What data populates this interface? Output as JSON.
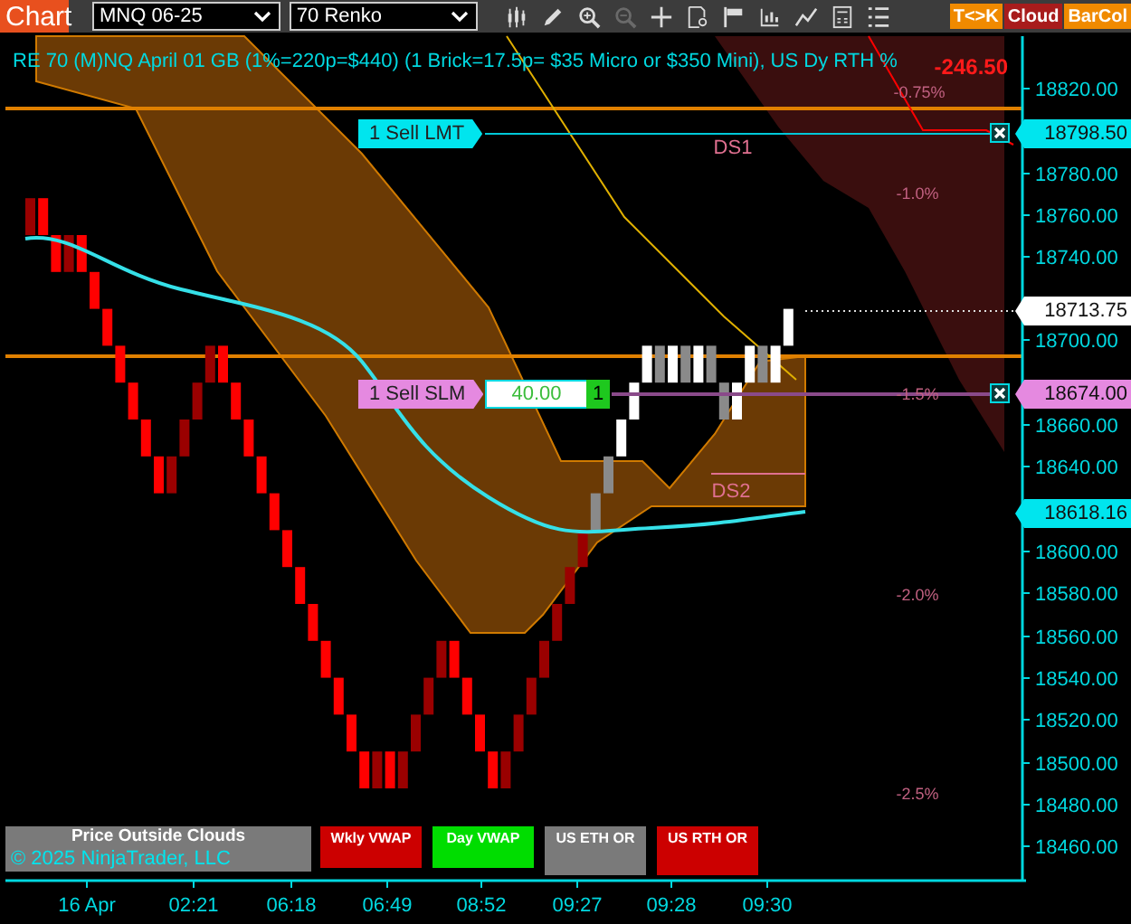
{
  "toolbar": {
    "app_button": "Chart",
    "instrument": "MNQ 06-25",
    "interval": "70 Renko",
    "tools": [
      {
        "disabled": false
      },
      {
        "disabled": false
      },
      {
        "disabled": false
      },
      {
        "disabled": true
      },
      {
        "disabled": false
      },
      {
        "disabled": false
      },
      {
        "disabled": false
      },
      {
        "disabled": false
      },
      {
        "disabled": false
      },
      {
        "disabled": false
      },
      {
        "disabled": false
      }
    ],
    "toggles": [
      {
        "label": "T<>K",
        "color": "#f08a00"
      },
      {
        "label": "Cloud",
        "color": "#a81c1c"
      },
      {
        "label": "BarCol",
        "color": "#f08a00"
      }
    ]
  },
  "chart": {
    "title": "RE 70 (M)NQ April 01 GB (1%=220p=$440) (1 Brick=17.5p= $35 Micro or $350 Mini), US Dy RTH %",
    "loss_reading": "-246.50",
    "percent_labels": [
      "-0.75%",
      "-1.0%",
      "-1.5%",
      "-2.0%",
      "-2.5%"
    ],
    "zone_labels": [
      "DS1",
      "DS2"
    ],
    "orders": [
      {
        "label": "1 Sell LMT",
        "price": "18798.50",
        "color": "#00e5ee"
      },
      {
        "label": "1 Sell SLM",
        "price": "18674.00",
        "color": "#e589e0",
        "quantity": "40.00",
        "count": "1"
      }
    ],
    "price_markers": [
      {
        "price": "18713.75",
        "color": "#ffffff"
      },
      {
        "price": "18618.16",
        "color": "#00e5ee"
      }
    ],
    "price_ticks": [
      "18820.00",
      "18780.00",
      "18760.00",
      "18740.00",
      "18700.00",
      "18660.00",
      "18640.00",
      "18600.00",
      "18580.00",
      "18560.00",
      "18540.00",
      "18520.00",
      "18500.00",
      "18480.00",
      "18460.00"
    ],
    "time_ticks": [
      "16 Apr",
      "02:21",
      "06:18",
      "06:49",
      "08:52",
      "09:27",
      "09:28",
      "09:30"
    ],
    "legend": {
      "title": "Price Outside Clouds",
      "copyright": "© 2025 NinjaTrader, LLC"
    },
    "indicators": [
      {
        "label": "Wkly VWAP",
        "color": "#cc0000"
      },
      {
        "label": "Day VWAP",
        "color": "#00dd00"
      },
      {
        "label": "US ETH OR",
        "color": "#7a7a7a"
      },
      {
        "label": "US RTH OR",
        "color": "#cc0000"
      }
    ]
  }
}
